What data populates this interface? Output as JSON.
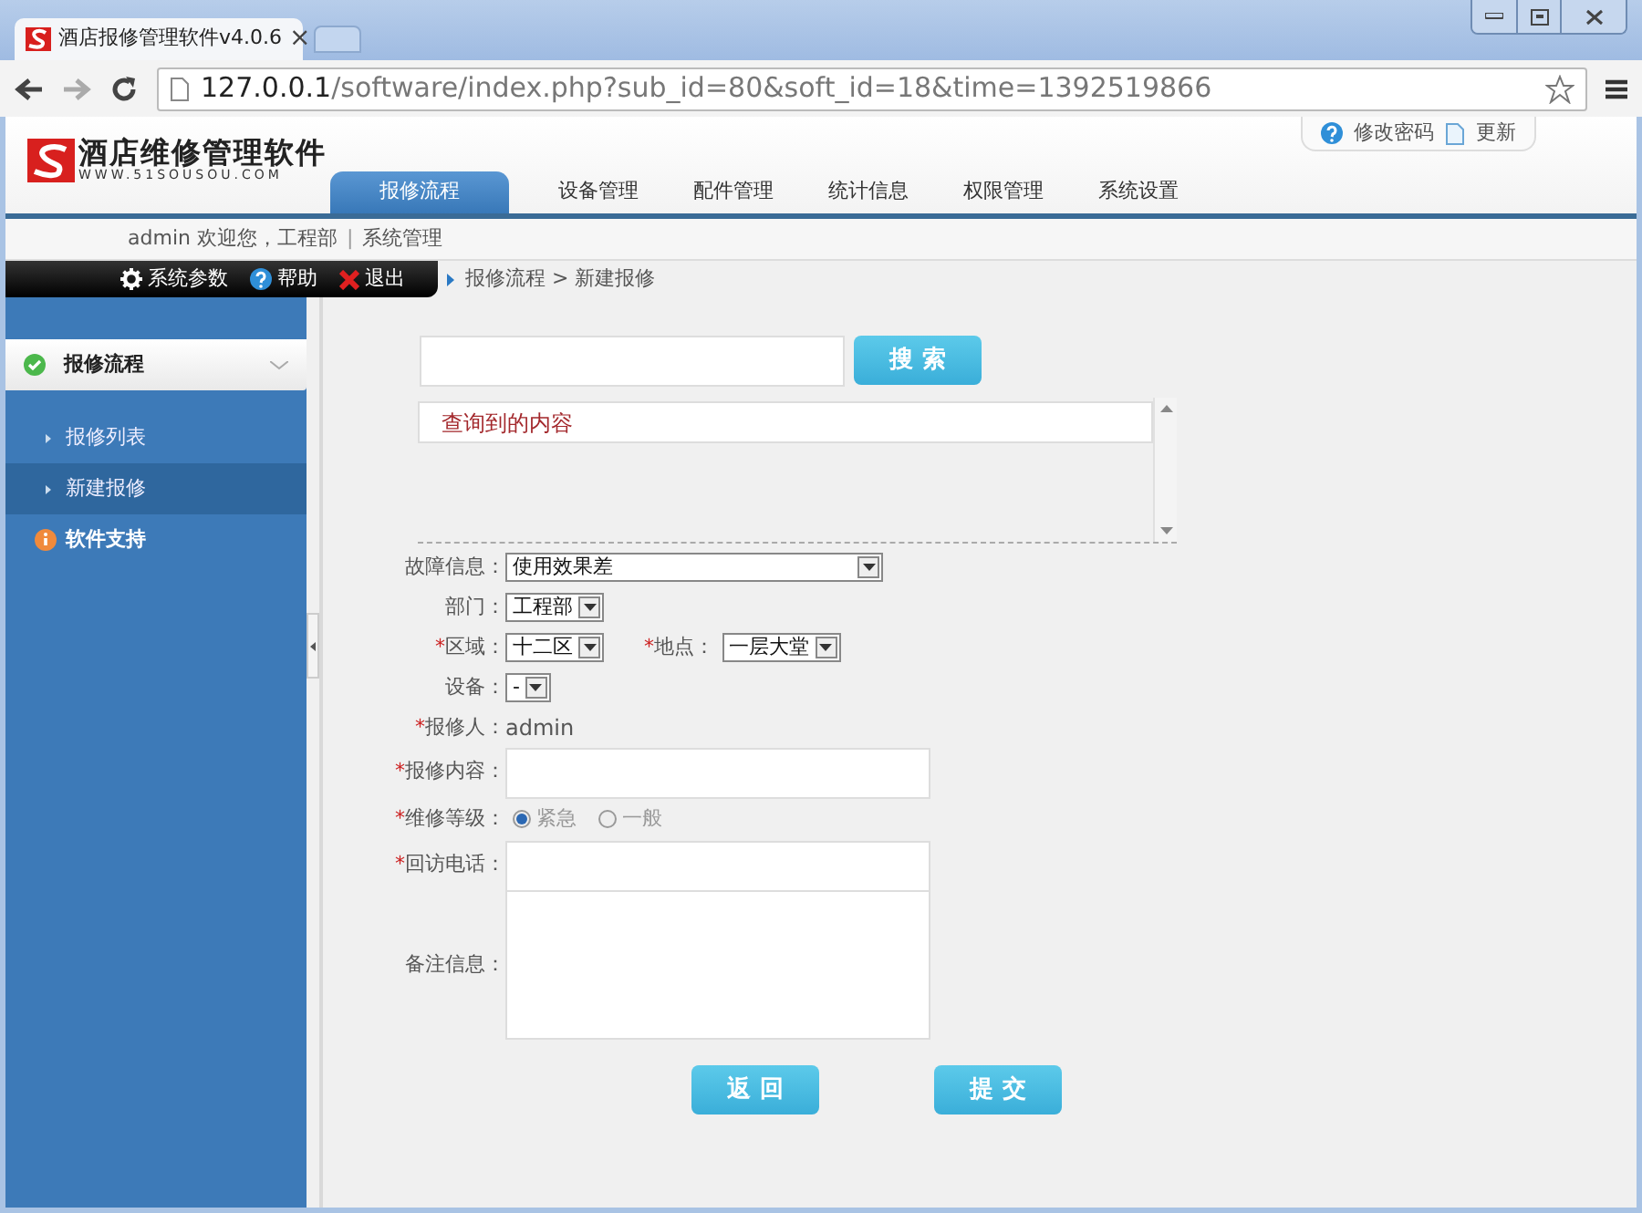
{
  "browser": {
    "tab_title": "酒店报修管理软件v4.0.6",
    "tab_close": "×",
    "url_host": "127.0.0.1",
    "url_path": "/software/index.php?sub_id=80&soft_id=18&time=1392519866"
  },
  "header": {
    "logo_title": "酒店维修管理软件",
    "logo_subtitle": "WWW.51SOUSOU.COM",
    "top_links": [
      {
        "label": "修改密码",
        "kind": "help"
      },
      {
        "label": "更新",
        "kind": "page"
      }
    ],
    "nav_tabs": [
      {
        "label": "报修流程",
        "selected": true
      },
      {
        "label": "设备管理",
        "selected": false
      },
      {
        "label": "配件管理",
        "selected": false
      },
      {
        "label": "统计信息",
        "selected": false
      },
      {
        "label": "权限管理",
        "selected": false
      },
      {
        "label": "系统设置",
        "selected": false
      }
    ],
    "welcome": "admin 欢迎您，工程部",
    "separator": "|",
    "welcome_link": "系统管理"
  },
  "toolbar": [
    {
      "label": "系统参数",
      "kind": "gear"
    },
    {
      "label": "帮助",
      "kind": "help"
    },
    {
      "label": "退出",
      "kind": "exit"
    }
  ],
  "breadcrumb": "报修流程 > 新建报修",
  "sidebar": [
    {
      "label": "报修流程",
      "kind": "check",
      "expanded": true,
      "children": [
        {
          "label": "报修列表",
          "selected": false
        },
        {
          "label": "新建报修",
          "selected": true
        }
      ]
    },
    {
      "label": "软件支持",
      "kind": "info",
      "expanded": false
    }
  ],
  "search": {
    "button": "搜 索",
    "results": [
      "查询到的内容"
    ]
  },
  "form": [
    {
      "items": [
        {
          "label": "故障信息：",
          "kind": "select",
          "value": "使用效果差",
          "wide": true
        }
      ]
    },
    {
      "items": [
        {
          "label": "部门：",
          "kind": "select",
          "value": "工程部"
        }
      ]
    },
    {
      "items": [
        {
          "label": "区域：",
          "mark": "*",
          "kind": "select",
          "value": "十二区"
        },
        {
          "label": "地点：",
          "mark": "*",
          "kind": "select",
          "value": "一层大堂"
        }
      ]
    },
    {
      "items": [
        {
          "label": "设备：",
          "kind": "select",
          "value": "-"
        }
      ]
    },
    {
      "items": [
        {
          "label": "报修人：",
          "mark": "*",
          "kind": "static",
          "value": "admin"
        }
      ]
    },
    {
      "items": [
        {
          "label": "报修内容：",
          "mark": "*",
          "kind": "input"
        }
      ]
    },
    {
      "items": [
        {
          "label": "维修等级：",
          "mark": "*",
          "kind": "radio",
          "options": [
            {
              "label": "紧急",
              "selected": true
            },
            {
              "label": "一般",
              "selected": false
            }
          ]
        }
      ]
    },
    {
      "items": [
        {
          "label": "回访电话：",
          "mark": "*",
          "kind": "input"
        }
      ]
    },
    {
      "items": [
        {
          "label": "备注信息：",
          "kind": "textarea"
        }
      ]
    }
  ],
  "buttons": [
    "返 回",
    "提 交"
  ]
}
